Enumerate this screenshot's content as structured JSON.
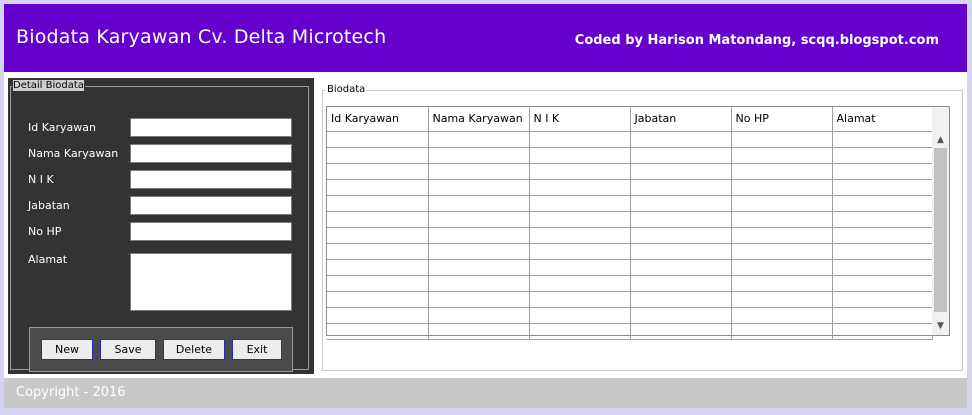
{
  "header": {
    "title": "Biodata Karyawan Cv. Delta Microtech",
    "credit": "Coded by Harison Matondang, scqq.blogspot.com"
  },
  "form": {
    "legend": "Detail Biodata",
    "fields": {
      "id_karyawan": {
        "label": "Id Karyawan",
        "value": ""
      },
      "nama_karyawan": {
        "label": "Nama Karyawan",
        "value": ""
      },
      "nik": {
        "label": "N I K",
        "value": ""
      },
      "jabatan": {
        "label": "Jabatan",
        "value": ""
      },
      "no_hp": {
        "label": "No HP",
        "value": ""
      },
      "alamat": {
        "label": "Alamat",
        "value": ""
      }
    },
    "buttons": {
      "new": "New",
      "save": "Save",
      "delete": "Delete",
      "exit": "Exit"
    }
  },
  "table": {
    "legend": "Biodata",
    "columns": [
      "Id Karyawan",
      "Nama Karyawan",
      "N I K",
      "Jabatan",
      "No HP",
      "Alamat"
    ],
    "empty_rows": 13
  },
  "scrollbar": {
    "up_icon": "chevron-up-icon",
    "down_icon": "chevron-down-icon"
  },
  "footer": {
    "copyright": "Copyright - 2016"
  },
  "colors": {
    "header_bg": "#6600cc",
    "panel_bg": "#333333",
    "footer_bg": "#c8c8c8",
    "page_bg": "#d5d3f2"
  }
}
